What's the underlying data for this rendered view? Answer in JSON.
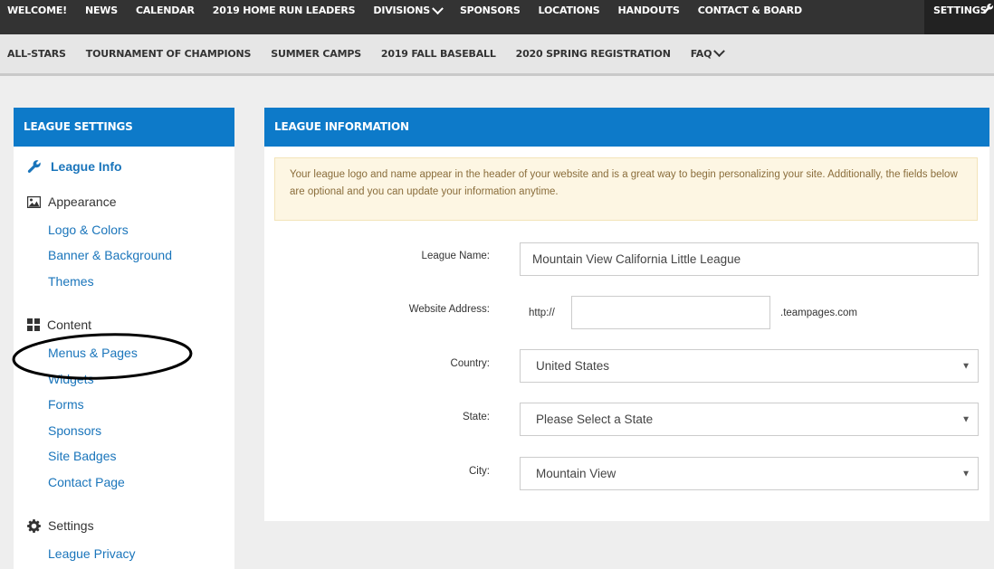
{
  "top_nav": {
    "items": [
      "WELCOME!",
      "NEWS",
      "CALENDAR",
      "2019 HOME RUN LEADERS",
      "DIVISIONS",
      "SPONSORS",
      "LOCATIONS",
      "HANDOUTS",
      "CONTACT & BOARD"
    ],
    "settings_label": "SETTINGS"
  },
  "sub_nav": {
    "items": [
      "ALL-STARS",
      "TOURNAMENT OF CHAMPIONS",
      "SUMMER CAMPS",
      "2019 FALL BASEBALL",
      "2020 SPRING REGISTRATION",
      "FAQ"
    ]
  },
  "sidebar": {
    "title": "LEAGUE SETTINGS",
    "active_item": "League Info",
    "appearance": {
      "label": "Appearance",
      "links": [
        "Logo & Colors",
        "Banner & Background",
        "Themes"
      ]
    },
    "content": {
      "label": "Content",
      "links": [
        "Menus & Pages",
        "Widgets",
        "Forms",
        "Sponsors",
        "Site Badges",
        "Contact Page"
      ]
    },
    "settings": {
      "label": "Settings",
      "links": [
        "League Privacy"
      ]
    }
  },
  "main": {
    "title": "LEAGUE INFORMATION",
    "notice": "Your league logo and name appear in the header of your website and is a great way to begin personalizing your site. Additionally, the fields below are optional and you can update your information anytime.",
    "form": {
      "league_name_label": "League Name:",
      "league_name_value": "Mountain View California Little League",
      "website_label": "Website Address:",
      "website_prefix": "http://",
      "website_value": "",
      "website_suffix": ".teampages.com",
      "country_label": "Country:",
      "country_value": "United States",
      "state_label": "State:",
      "state_value": "Please Select a State",
      "city_label": "City:",
      "city_value": "Mountain View"
    }
  },
  "colors": {
    "accent_blue": "#0d7ac9",
    "link_blue": "#1a75bb",
    "topbar": "#333333",
    "notice_bg": "#fdf6e3"
  }
}
